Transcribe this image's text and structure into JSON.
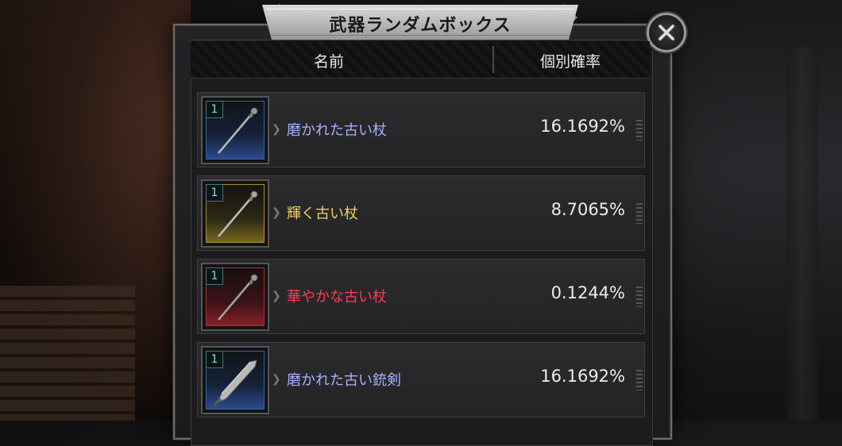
{
  "dialog": {
    "title": "武器ランダムボックス",
    "close_icon": "close-icon"
  },
  "table": {
    "header_name": "名前",
    "header_rate": "個別確率"
  },
  "items": [
    {
      "quantity": "1",
      "name": "磨かれた古い杖",
      "rate": "16.1692%",
      "rarity_color": "#a6b0ff",
      "frame": "blue",
      "icon": "staff-icon"
    },
    {
      "quantity": "1",
      "name": "輝く古い杖",
      "rate": "8.7065%",
      "rarity_color": "#f0d060",
      "frame": "gold",
      "icon": "staff-icon"
    },
    {
      "quantity": "1",
      "name": "華やかな古い杖",
      "rate": "0.1244%",
      "rarity_color": "#ff3a55",
      "frame": "red",
      "icon": "staff-icon"
    },
    {
      "quantity": "1",
      "name": "磨かれた古い銃剣",
      "rate": "16.1692%",
      "rarity_color": "#a6b0ff",
      "frame": "blue",
      "icon": "greatsword-icon"
    }
  ]
}
